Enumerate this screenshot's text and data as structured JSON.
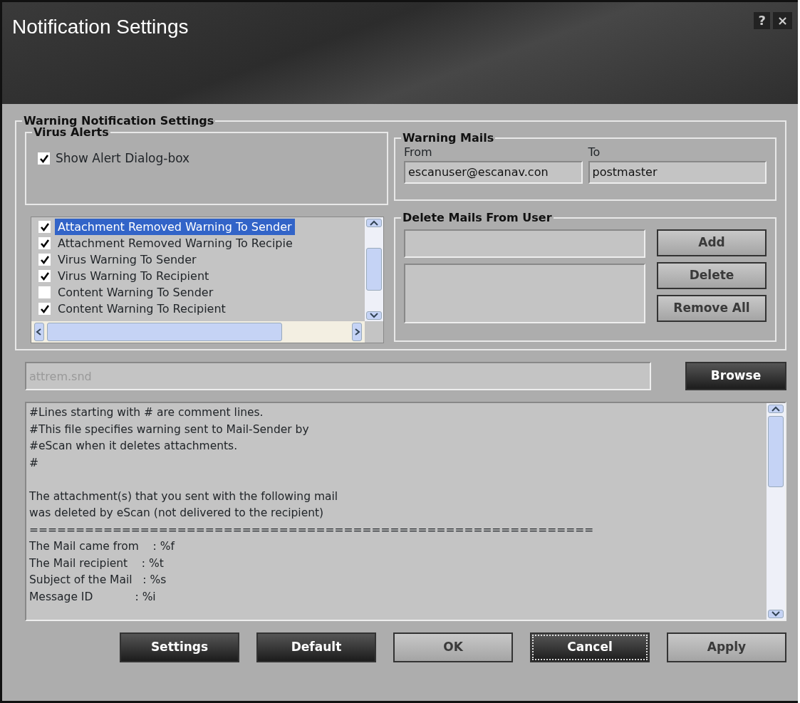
{
  "window": {
    "title": "Notification Settings",
    "help": "?",
    "close": "×"
  },
  "group_title": "Warning Notification Settings",
  "virus_alerts": {
    "title": "Virus Alerts",
    "show_alert": {
      "label": "Show Alert Dialog-box",
      "checked": true
    }
  },
  "warnings": [
    {
      "label": "Attachment Removed Warning To Sender",
      "checked": true,
      "selected": true
    },
    {
      "label": "Attachment Removed Warning To Recipie",
      "checked": true,
      "selected": false
    },
    {
      "label": "Virus Warning To Sender",
      "checked": true,
      "selected": false
    },
    {
      "label": "Virus Warning To Recipient",
      "checked": true,
      "selected": false
    },
    {
      "label": "Content Warning To Sender",
      "checked": false,
      "selected": false
    },
    {
      "label": "Content Warning To Recipient",
      "checked": true,
      "selected": false
    }
  ],
  "warning_mails": {
    "title": "Warning Mails",
    "from_label": "From",
    "from": "escanuser@escanav.con",
    "to_label": "To",
    "to": "postmaster"
  },
  "delete_mails": {
    "title": "Delete Mails From User",
    "buttons": [
      {
        "label": "Add",
        "disabled": true
      },
      {
        "label": "Delete",
        "disabled": true
      },
      {
        "label": "Remove All",
        "disabled": true
      }
    ]
  },
  "sound_file": {
    "value": "attrem.snd",
    "disabled": true
  },
  "browse": {
    "label": "Browse",
    "disabled": false
  },
  "message_blocks": [
    [
      "#Lines starting with # are comment lines.",
      "#This file specifies warning sent to Mail-Sender by",
      "#eScan when it deletes attachments.",
      "#"
    ],
    [
      "The attachment(s) that you sent with the following mail",
      "was deleted by eScan (not delivered to the recipient)",
      "=============================================================",
      "The Mail came from    : %f",
      "The Mail recipient    : %t",
      "Subject of the Mail   : %s",
      "Message ID            : %i"
    ]
  ],
  "footer_buttons": [
    {
      "label": "Settings",
      "disabled": false,
      "focused": false
    },
    {
      "label": "Default",
      "disabled": false,
      "focused": false
    },
    {
      "label": "OK",
      "disabled": true,
      "focused": false
    },
    {
      "label": "Cancel",
      "disabled": false,
      "focused": true
    },
    {
      "label": "Apply",
      "disabled": true,
      "focused": false
    }
  ]
}
